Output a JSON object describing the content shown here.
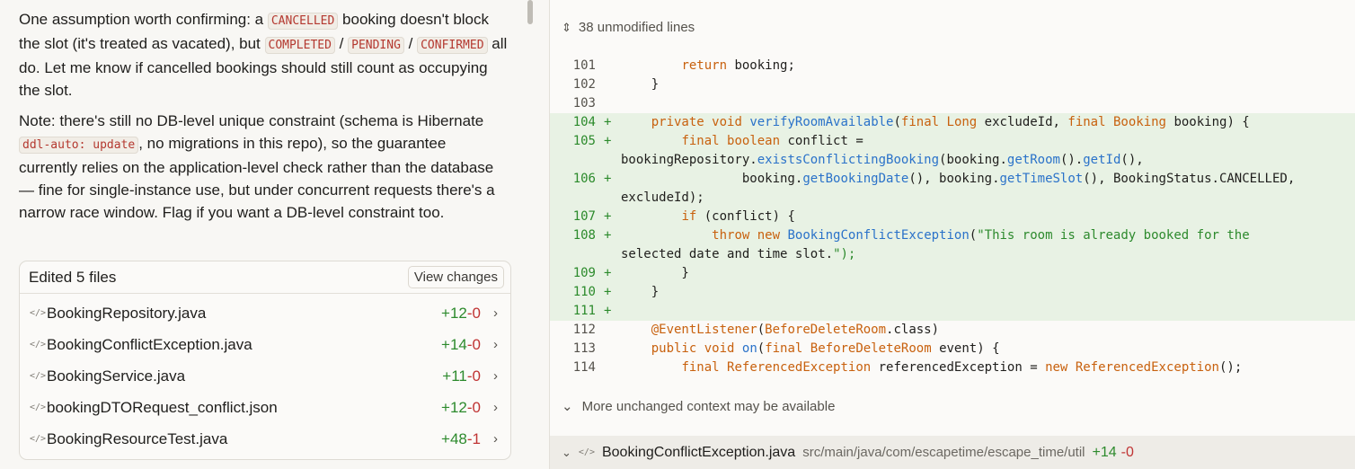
{
  "chat": {
    "p1": {
      "t1": "One assumption worth confirming: a ",
      "code1": "CANCELLED",
      "t2": " booking doesn't block the slot (it's treated as vacated), but ",
      "code2": "COMPLETED",
      "sep1": " / ",
      "code3": "PENDING",
      "sep2": " / ",
      "code4": "CONFIRMED",
      "t3": " all do. Let me know if cancelled bookings should still count as occupying the slot."
    },
    "p2": {
      "t1": "Note: there's still no DB-level unique constraint (schema is Hibernate ",
      "code1": "ddl-auto: update",
      "t2": ", no migrations in this repo), so the guarantee currently relies on the application-level check rather than the database — fine for single-instance use, but under concurrent requests there's a narrow race window. Flag if you want a DB-level constraint too."
    },
    "edited": {
      "title": "Edited 5 files",
      "view_changes": "View changes",
      "files": [
        {
          "name": "BookingRepository.java",
          "add": "+12",
          "del": "-0"
        },
        {
          "name": "BookingConflictException.java",
          "add": "+14",
          "del": "-0"
        },
        {
          "name": "BookingService.java",
          "add": "+11",
          "del": "-0"
        },
        {
          "name": "bookingDTORequest_conflict.json",
          "add": "+12",
          "del": "-0"
        },
        {
          "name": "BookingResourceTest.java",
          "add": "+48",
          "del": "-1"
        }
      ]
    }
  },
  "diff": {
    "collapsed_top": "38 unmodified lines",
    "lines": [
      {
        "n": "101",
        "t": "        return booking;"
      },
      {
        "n": "102",
        "t": "    }"
      },
      {
        "n": "103",
        "t": ""
      },
      {
        "n": "104",
        "t": "    private void verifyRoomAvailable(final Long excludeId, final Booking booking) {"
      },
      {
        "n": "105",
        "t": "        final boolean conflict =",
        "t2": "bookingRepository.existsConflictingBooking(booking.getRoom().getId(),"
      },
      {
        "n": "106",
        "t": "                booking.getBookingDate(), booking.getTimeSlot(), BookingStatus.CANCELLED,",
        "t2": "excludeId);"
      },
      {
        "n": "107",
        "t": "        if (conflict) {"
      },
      {
        "n": "108",
        "t": "            throw new BookingConflictException(\"This room is already booked for the",
        "t2": "selected date and time slot.\");"
      },
      {
        "n": "109",
        "t": "        }"
      },
      {
        "n": "110",
        "t": "    }"
      },
      {
        "n": "111",
        "t": ""
      },
      {
        "n": "112",
        "t": "    @EventListener(BeforeDeleteRoom.class)"
      },
      {
        "n": "113",
        "t": "    public void on(final BeforeDeleteRoom event) {"
      },
      {
        "n": "114",
        "t": "        final ReferencedException referencedException = new ReferencedException();"
      }
    ],
    "more_context": "More unchanged context may be available",
    "footer": {
      "file": "BookingConflictException.java",
      "path": "src/main/java/com/escapetime/escape_time/util",
      "add": "+14",
      "del": "-0"
    }
  },
  "colors": {
    "added_bg": "#e8f2e4",
    "add_green": "#2d8a2d",
    "del_red": "#c03434",
    "keyword": "#c8610e",
    "method": "#2a72c9"
  }
}
